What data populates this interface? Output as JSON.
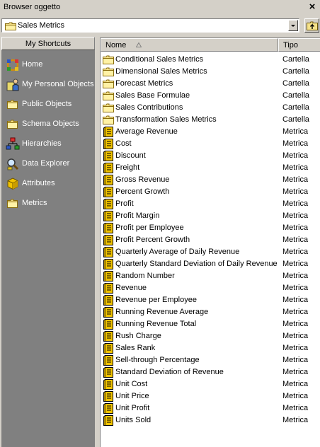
{
  "window": {
    "title": "Browser oggetto"
  },
  "address": {
    "path": "Sales Metrics"
  },
  "shortcuts": {
    "header": "My Shortcuts",
    "items": [
      {
        "label": "Home",
        "icon": "home-icon"
      },
      {
        "label": "My Personal Objects",
        "icon": "personal-objects-icon"
      },
      {
        "label": "Public Objects",
        "icon": "folder-icon"
      },
      {
        "label": "Schema Objects",
        "icon": "folder-icon"
      },
      {
        "label": "Hierarchies",
        "icon": "hierarchy-icon"
      },
      {
        "label": "Data Explorer",
        "icon": "data-explorer-icon"
      },
      {
        "label": "Attributes",
        "icon": "attribute-cube-icon"
      },
      {
        "label": "Metrics",
        "icon": "folder-icon"
      }
    ]
  },
  "list": {
    "columns": {
      "name": "Nome",
      "type": "Tipo"
    },
    "rows": [
      {
        "name": "Conditional Sales Metrics",
        "type": "Cartella",
        "icon": "folder"
      },
      {
        "name": "Dimensional Sales Metrics",
        "type": "Cartella",
        "icon": "folder"
      },
      {
        "name": "Forecast Metrics",
        "type": "Cartella",
        "icon": "folder"
      },
      {
        "name": "Sales Base Formulae",
        "type": "Cartella",
        "icon": "folder"
      },
      {
        "name": "Sales Contributions",
        "type": "Cartella",
        "icon": "folder"
      },
      {
        "name": "Transformation Sales Metrics",
        "type": "Cartella",
        "icon": "folder"
      },
      {
        "name": "Average Revenue",
        "type": "Metrica",
        "icon": "metric"
      },
      {
        "name": "Cost",
        "type": "Metrica",
        "icon": "metric"
      },
      {
        "name": "Discount",
        "type": "Metrica",
        "icon": "metric"
      },
      {
        "name": "Freight",
        "type": "Metrica",
        "icon": "metric"
      },
      {
        "name": "Gross Revenue",
        "type": "Metrica",
        "icon": "metric"
      },
      {
        "name": "Percent Growth",
        "type": "Metrica",
        "icon": "metric"
      },
      {
        "name": "Profit",
        "type": "Metrica",
        "icon": "metric"
      },
      {
        "name": "Profit Margin",
        "type": "Metrica",
        "icon": "metric"
      },
      {
        "name": "Profit per Employee",
        "type": "Metrica",
        "icon": "metric"
      },
      {
        "name": "Profit Percent Growth",
        "type": "Metrica",
        "icon": "metric"
      },
      {
        "name": "Quarterly Average of Daily Revenue",
        "type": "Metrica",
        "icon": "metric"
      },
      {
        "name": "Quarterly Standard Deviation of Daily Revenue",
        "type": "Metrica",
        "icon": "metric"
      },
      {
        "name": "Random Number",
        "type": "Metrica",
        "icon": "metric"
      },
      {
        "name": "Revenue",
        "type": "Metrica",
        "icon": "metric"
      },
      {
        "name": "Revenue per Employee",
        "type": "Metrica",
        "icon": "metric"
      },
      {
        "name": "Running Revenue Average",
        "type": "Metrica",
        "icon": "metric"
      },
      {
        "name": "Running Revenue Total",
        "type": "Metrica",
        "icon": "metric"
      },
      {
        "name": "Rush Charge",
        "type": "Metrica",
        "icon": "metric"
      },
      {
        "name": "Sales Rank",
        "type": "Metrica",
        "icon": "metric"
      },
      {
        "name": "Sell-through Percentage",
        "type": "Metrica",
        "icon": "metric"
      },
      {
        "name": "Standard Deviation of Revenue",
        "type": "Metrica",
        "icon": "metric"
      },
      {
        "name": "Unit Cost",
        "type": "Metrica",
        "icon": "metric"
      },
      {
        "name": "Unit Price",
        "type": "Metrica",
        "icon": "metric"
      },
      {
        "name": "Unit Profit",
        "type": "Metrica",
        "icon": "metric"
      },
      {
        "name": "Units Sold",
        "type": "Metrica",
        "icon": "metric"
      }
    ]
  }
}
